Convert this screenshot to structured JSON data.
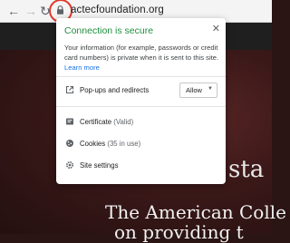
{
  "browser": {
    "url": "actecfoundation.org",
    "back_icon": "arrow-left-icon",
    "forward_icon": "arrow-right-icon",
    "reload_icon": "reload-icon",
    "lock_icon": "lock-icon"
  },
  "popup": {
    "title": "Connection is secure",
    "body": "Your information (for example, passwords or credit card numbers) is private when it is sent to this site.",
    "learn_more": "Learn more",
    "popups": {
      "label": "Pop-ups and redirects",
      "value": "Allow"
    },
    "certificate": {
      "label": "Certificate",
      "status": "(Valid)"
    },
    "cookies": {
      "label": "Cookies",
      "status": "(35 in use)"
    },
    "site_settings": "Site settings",
    "accent_color": "#1e8e3e",
    "link_color": "#1a73e8"
  },
  "page": {
    "hero_line1": "The American Colle",
    "hero_line2": "on providing t",
    "side_text": "sta"
  }
}
